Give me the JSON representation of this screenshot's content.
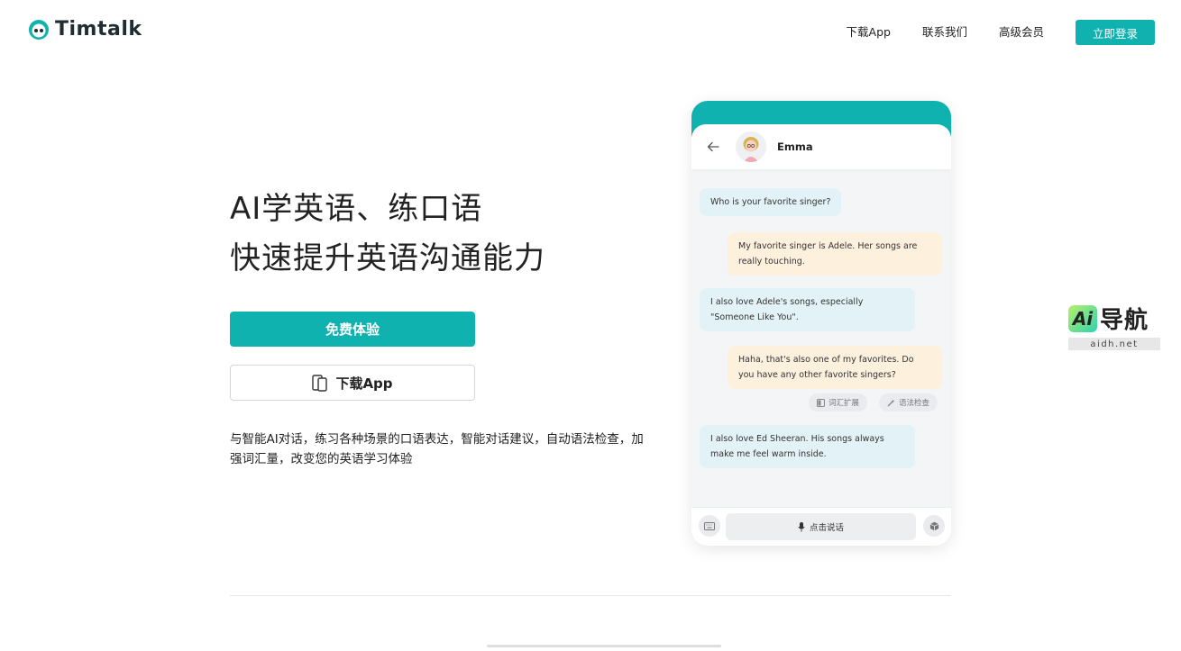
{
  "brand": {
    "name": "Timtalk",
    "accent_color": "#10b2b0"
  },
  "nav": {
    "items": [
      "下载App",
      "联系我们",
      "高级会员"
    ],
    "login_label": "立即登录"
  },
  "hero": {
    "title_line1": "AI学英语、练口语",
    "title_line2": "快速提升英语沟通能力",
    "trial_button": "免费体验",
    "download_button": "下载App",
    "description": "与智能AI对话，练习各种场景的口语表达，智能对话建议，自动语法检查，加强词汇量，改变您的英语学习体验"
  },
  "phone": {
    "contact_name": "Emma",
    "messages": [
      {
        "from": "ai",
        "text": "Who is your favorite singer?"
      },
      {
        "from": "user",
        "text": "My favorite singer is Adele. Her songs are really touching."
      },
      {
        "from": "ai",
        "text": "I also love Adele's songs, especially \"Someone Like You\"."
      },
      {
        "from": "user",
        "text": "Haha, that's also one of my favorites. Do you have any other favorite singers?"
      },
      {
        "from": "ai",
        "text": "I also love Ed Sheeran. His songs always make me feel warm inside."
      }
    ],
    "chips": [
      "词汇扩展",
      "语法检查"
    ],
    "talk_button": "点击说话"
  },
  "watermark": {
    "logo_text": "导航",
    "logo_badge": "Ai",
    "domain": "aidh.net"
  }
}
